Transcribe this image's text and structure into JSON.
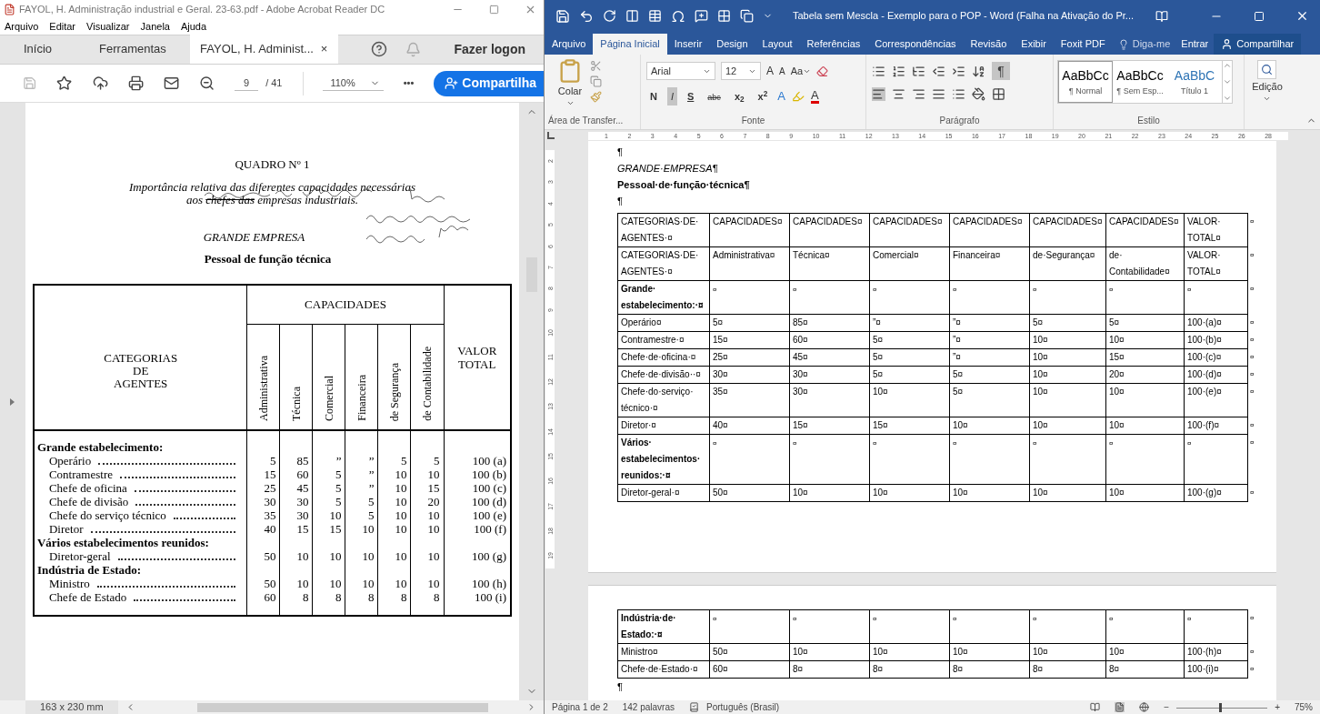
{
  "pdf_window": {
    "title": "FAYOL, H. Administração industrial e Geral. 23-63.pdf - Adobe Acrobat Reader DC",
    "menu": [
      "Arquivo",
      "Editar",
      "Visualizar",
      "Janela",
      "Ajuda"
    ],
    "tabs": [
      {
        "label": "Início",
        "selected": false
      },
      {
        "label": "Ferramentas",
        "selected": false
      },
      {
        "label": "FAYOL, H. Administ...",
        "selected": true
      }
    ],
    "tab_close": "×",
    "login": "Fazer logon",
    "page_number": "9",
    "page_total": "/ 41",
    "zoom": "110%",
    "more": "•••",
    "share": "Compartilha",
    "document": {
      "heading": "QUADRO Nº 1",
      "caption": [
        [
          {
            "text": "Importância relativa das diferentes capacidades necessárias",
            "struck": false
          }
        ],
        [
          {
            "text": "aos ",
            "struck": false
          },
          {
            "text": "chefes das",
            "struck": true
          },
          {
            "text": " empresas industriais.",
            "struck": false
          }
        ]
      ],
      "subheading": "GRANDE EMPRESA",
      "section": "Pessoal de função técnica",
      "table": {
        "row_header": [
          "CATEGORIAS",
          "DE",
          "AGENTES"
        ],
        "group_header": "CAPACIDADES",
        "columns": [
          "Administrativa",
          "Técnica",
          "Comercial",
          "Financeira",
          "de Segurança",
          "de Contabilidade"
        ],
        "total_header": [
          "VALOR",
          "TOTAL"
        ],
        "rows": [
          {
            "kind": "group",
            "label": "Grande estabelecimento:"
          },
          {
            "kind": "item",
            "label": "Operário",
            "values": [
              "5",
              "85",
              "”",
              "”",
              "5",
              "5"
            ],
            "total": "100 (a)"
          },
          {
            "kind": "item",
            "label": "Contramestre",
            "values": [
              "15",
              "60",
              "5",
              "”",
              "10",
              "10"
            ],
            "total": "100 (b)"
          },
          {
            "kind": "item",
            "label": "Chefe de oficina",
            "values": [
              "25",
              "45",
              "5",
              "”",
              "10",
              "15"
            ],
            "total": "100 (c)"
          },
          {
            "kind": "item",
            "label": "Chefe de divisão",
            "values": [
              "30",
              "30",
              "5",
              "5",
              "10",
              "20"
            ],
            "total": "100 (d)"
          },
          {
            "kind": "item",
            "label": "Chefe do serviço técnico",
            "values": [
              "35",
              "30",
              "10",
              "5",
              "10",
              "10"
            ],
            "total": "100 (e)"
          },
          {
            "kind": "item",
            "label": "Diretor",
            "values": [
              "40",
              "15",
              "15",
              "10",
              "10",
              "10"
            ],
            "total": "100 (f)"
          },
          {
            "kind": "group",
            "label": "Vários estabelecimentos reunidos:"
          },
          {
            "kind": "item",
            "label": "Diretor-geral",
            "values": [
              "50",
              "10",
              "10",
              "10",
              "10",
              "10"
            ],
            "total": "100 (g)"
          },
          {
            "kind": "group",
            "label": "Indústria de Estado:"
          },
          {
            "kind": "item",
            "label": "Ministro",
            "values": [
              "50",
              "10",
              "10",
              "10",
              "10",
              "10"
            ],
            "total": "100 (h)"
          },
          {
            "kind": "item",
            "label": "Chefe de Estado",
            "values": [
              "60",
              "8",
              "8",
              "8",
              "8",
              "8"
            ],
            "total": "100 (i)"
          }
        ]
      }
    },
    "page_size": "163 x 230 mm"
  },
  "word_window": {
    "title": "Tabela sem Mescla - Exemplo para o POP - Word (Falha na Ativação do Pr...",
    "tabs": [
      {
        "label": "Arquivo",
        "selected": false
      },
      {
        "label": "Página Inicial",
        "selected": true
      },
      {
        "label": "Inserir",
        "selected": false
      },
      {
        "label": "Design",
        "selected": false
      },
      {
        "label": "Layout",
        "selected": false
      },
      {
        "label": "Referências",
        "selected": false
      },
      {
        "label": "Correspondências",
        "selected": false
      },
      {
        "label": "Revisão",
        "selected": false
      },
      {
        "label": "Exibir",
        "selected": false
      },
      {
        "label": "Foxit PDF",
        "selected": false
      }
    ],
    "tell_me": "Diga-me",
    "sign_in": "Entrar",
    "share": "Compartilhar",
    "ribbon": {
      "paste": "Colar",
      "clipboard_label": "Área de Transfer...",
      "font_name": "Arial",
      "font_size": "12",
      "grow_font": "A",
      "shrink_font": "A",
      "change_case": "Aa",
      "text_effects": "A",
      "font_color": "A",
      "formats": [
        {
          "text": "N",
          "active": false
        },
        {
          "text": "I",
          "active": true
        },
        {
          "text": "S",
          "active": false
        },
        {
          "text": "abc",
          "active": false
        },
        {
          "text": "x$_{2}$",
          "active": false
        },
        {
          "text": "x$^{2}$",
          "active": false
        }
      ],
      "font_label": "Fonte",
      "pilcrow": {
        "text": "¶",
        "on": true
      },
      "paragraph_label": "Parágrafo",
      "styles": [
        {
          "sample": "AaBbCc",
          "name": "¶ Normal",
          "kind": "body",
          "selected": true
        },
        {
          "sample": "AaBbCc",
          "name": "¶ Sem Esp...",
          "kind": "body",
          "selected": false
        },
        {
          "sample": "AaBbC",
          "name": "Título 1",
          "kind": "heading",
          "selected": false
        }
      ],
      "styles_label": "Estilo",
      "editing": "Edição"
    },
    "ruler": [
      "1",
      "2",
      "3",
      "4",
      "5",
      "6",
      "7",
      "8",
      "9",
      "10",
      "11",
      "12",
      "13",
      "14",
      "15",
      "16",
      "17",
      "18",
      "19",
      "20",
      "21",
      "22",
      "23",
      "24",
      "25",
      "26",
      "28"
    ],
    "vertical_ruler": [
      "2",
      "3",
      "4",
      "5",
      "6",
      "7",
      "8",
      "9",
      "10",
      "11",
      "12",
      "13",
      "14",
      "15",
      "16",
      "17",
      "18",
      "19"
    ],
    "page_1": {
      "paragraphs": [
        {
          "text": "¶",
          "kind": "plain"
        },
        {
          "text": "GRANDE·EMPRESA¶",
          "kind": "italic"
        },
        {
          "text": "Pessoal·de·função·técnica¶",
          "kind": "bold"
        },
        {
          "text": "¶",
          "kind": "plain"
        }
      ],
      "table": [
        {
          "kind": "header",
          "cells": [
            "CATEGORIAS·DE·AGENTES·¤",
            "CAPACIDADES¤",
            "CAPACIDADES¤",
            "CAPACIDADES¤",
            "CAPACIDADES¤",
            "CAPACIDADES¤",
            "CAPACIDADES¤",
            "VALOR·TOTAL¤"
          ],
          "end": "¤"
        },
        {
          "kind": "header",
          "cells": [
            "CATEGORIAS·DE·AGENTES·¤",
            "Administrativa¤",
            "Técnica¤",
            "Comercial¤",
            "Financeira¤",
            "de·Segurança¤",
            "de·Contabilidade¤",
            "VALOR·TOTAL¤"
          ],
          "end": "¤"
        },
        {
          "kind": "group",
          "cells": [
            "Grande·estabelecimento:·¤",
            "¤",
            "¤",
            "¤",
            "¤",
            "¤",
            "¤",
            "¤"
          ],
          "end": "¤"
        },
        {
          "kind": "item",
          "cells": [
            "Operário¤",
            "5¤",
            "85¤",
            "”¤",
            "”¤",
            "5¤",
            "5¤",
            "100·(a)¤"
          ],
          "end": "¤"
        },
        {
          "kind": "item",
          "cells": [
            "Contramestre·¤",
            "15¤",
            "60¤",
            "5¤",
            "”¤",
            "10¤",
            "10¤",
            "100·(b)¤"
          ],
          "end": "¤"
        },
        {
          "kind": "item",
          "cells": [
            "Chefe·de·oficina·¤",
            "25¤",
            "45¤",
            "5¤",
            "”¤",
            "10¤",
            "15¤",
            "100·(c)¤"
          ],
          "end": "¤"
        },
        {
          "kind": "item",
          "cells": [
            "Chefe·de·divisão··¤",
            "30¤",
            "30¤",
            "5¤",
            "5¤",
            "10¤",
            "20¤",
            "100·(d)¤"
          ],
          "end": "¤"
        },
        {
          "kind": "item",
          "cells": [
            "Chefe·do·serviço·técnico·¤",
            "35¤",
            "30¤",
            "10¤",
            "5¤",
            "10¤",
            "10¤",
            "100·(e)¤"
          ],
          "end": "¤"
        },
        {
          "kind": "item",
          "cells": [
            "Diretor·¤",
            "40¤",
            "15¤",
            "15¤",
            "10¤",
            "10¤",
            "10¤",
            "100·(f)¤"
          ],
          "end": "¤"
        },
        {
          "kind": "group",
          "cells": [
            "Vários·estabelecimentos·reunidos:·¤",
            "¤",
            "¤",
            "¤",
            "¤",
            "¤",
            "¤",
            "¤"
          ],
          "end": "¤"
        },
        {
          "kind": "item",
          "cells": [
            "Diretor-geral·¤",
            "50¤",
            "10¤",
            "10¤",
            "10¤",
            "10¤",
            "10¤",
            "100·(g)¤"
          ],
          "end": "¤"
        }
      ]
    },
    "page_2": {
      "table": [
        {
          "kind": "group",
          "cells": [
            "Indústria·de·Estado:·¤",
            "¤",
            "¤",
            "¤",
            "¤",
            "¤",
            "¤",
            "¤"
          ],
          "end": "¤"
        },
        {
          "kind": "item",
          "cells": [
            "Ministro¤",
            "50¤",
            "10¤",
            "10¤",
            "10¤",
            "10¤",
            "10¤",
            "100·(h)¤"
          ],
          "end": "¤"
        },
        {
          "kind": "item",
          "cells": [
            "Chefe·de·Estado·¤",
            "60¤",
            "8¤",
            "8¤",
            "8¤",
            "8¤",
            "8¤",
            "100·(i)¤"
          ],
          "end": "¤"
        }
      ],
      "paragraphs": [
        {
          "text": "¶"
        }
      ]
    },
    "status": {
      "page": "Página 1 de 2",
      "words": "142 palavras",
      "language": "Português (Brasil)",
      "zoom": "75%",
      "zoom_level": {
        "level": 0.5
      },
      "minus": "−",
      "plus": "+"
    }
  }
}
